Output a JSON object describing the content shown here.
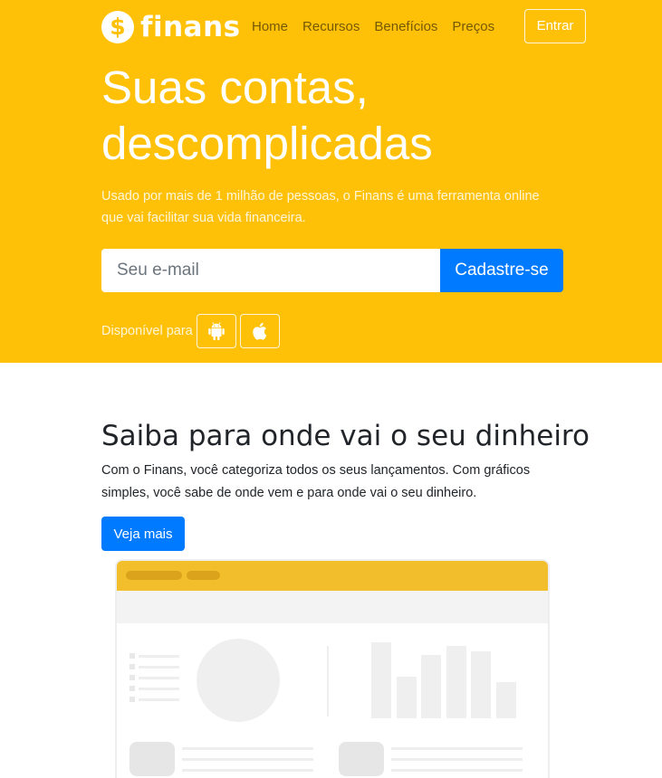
{
  "brand": {
    "logo_symbol": "$",
    "name": "finans"
  },
  "nav": {
    "items": [
      "Home",
      "Recursos",
      "Benefícios",
      "Preços"
    ],
    "login_label": "Entrar"
  },
  "hero": {
    "title_line1": "Suas contas,",
    "title_line2": "descomplicadas",
    "subtitle": "Usado por mais de 1 milhão de pessoas, o Finans é uma ferramenta online que vai facilitar sua vida financeira.",
    "email_placeholder": "Seu e-mail",
    "signup_label": "Cadastre-se",
    "available_label": "Disponível para",
    "stores": [
      "android-icon",
      "apple-icon"
    ]
  },
  "feature": {
    "title": "Saiba para onde vai o seu dinheiro",
    "text": "Com o Finans, você categoriza todos os seus lançamentos. Com gráficos simples, você sabe de onde vem e para onde vai o seu dinheiro.",
    "button_label": "Veja mais"
  },
  "colors": {
    "brand_yellow": "#ffc107",
    "primary_blue": "#007bff",
    "mockup_header": "#f2be2c"
  }
}
